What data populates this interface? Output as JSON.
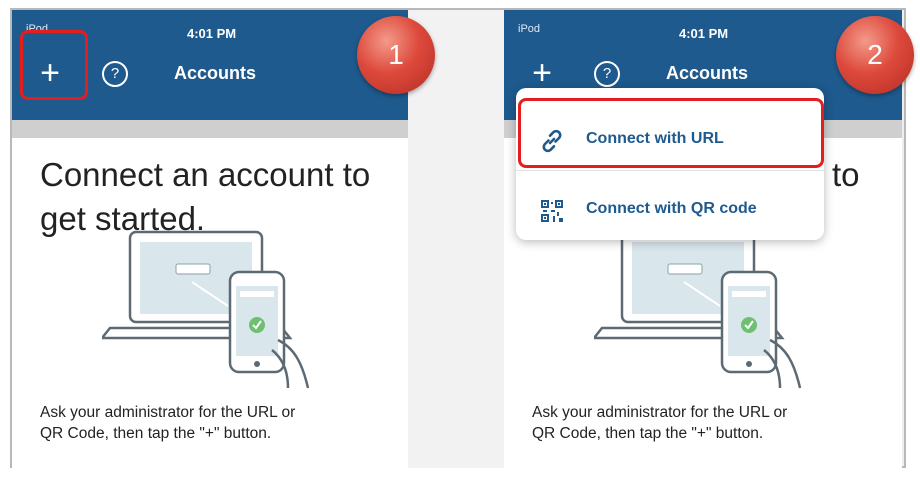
{
  "steps": [
    {
      "badge": "1",
      "status": {
        "device": "iPod",
        "time": "4:01 PM"
      },
      "nav": {
        "plus": "+",
        "help": "?",
        "title": "Accounts"
      },
      "heading_line1": "Connect an account to",
      "heading_line2": "get started.",
      "instructions_line1": "Ask your administrator for the URL or",
      "instructions_line2": "QR Code, then tap the \"+\" button."
    },
    {
      "badge": "2",
      "status": {
        "device": "iPod",
        "time": "4:01 PM"
      },
      "nav": {
        "plus": "+",
        "help": "?",
        "title": "Accounts"
      },
      "heading_visible_fragment": "to",
      "instructions_line1": "Ask your administrator for the URL or",
      "instructions_line2": "QR Code, then tap the \"+\" button.",
      "menu": [
        {
          "label": "Connect with URL",
          "icon": "link-icon"
        },
        {
          "label": "Connect with QR code",
          "icon": "qr-code-icon"
        }
      ]
    }
  ],
  "colors": {
    "navbar": "#1e5a8e",
    "highlight": "#e41e1e",
    "badge": "#d9473b",
    "menu_text": "#1e5a8e"
  }
}
